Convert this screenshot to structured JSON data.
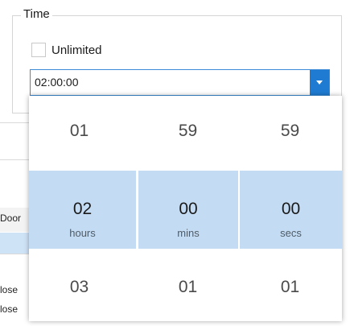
{
  "time_group": {
    "title": "Time",
    "unlimited_label": "Unlimited",
    "unlimited_checked": false,
    "value": "02:00:00"
  },
  "background_table": {
    "fragments": [
      "Door",
      "lose",
      "lose"
    ]
  },
  "picker": {
    "rows": [
      {
        "cells": [
          {
            "value": "01"
          },
          {
            "value": "59"
          },
          {
            "value": "59"
          }
        ]
      },
      {
        "cells": [
          {
            "value": "02",
            "unit": "hours"
          },
          {
            "value": "00",
            "unit": "mins"
          },
          {
            "value": "00",
            "unit": "secs"
          }
        ]
      },
      {
        "cells": [
          {
            "value": "03"
          },
          {
            "value": "01"
          },
          {
            "value": "01"
          }
        ]
      }
    ]
  },
  "colors": {
    "accent": "#1f7bd1",
    "selected_row": "#c4dcf3"
  },
  "icons": {
    "dropdown": "chevron-down-icon"
  }
}
